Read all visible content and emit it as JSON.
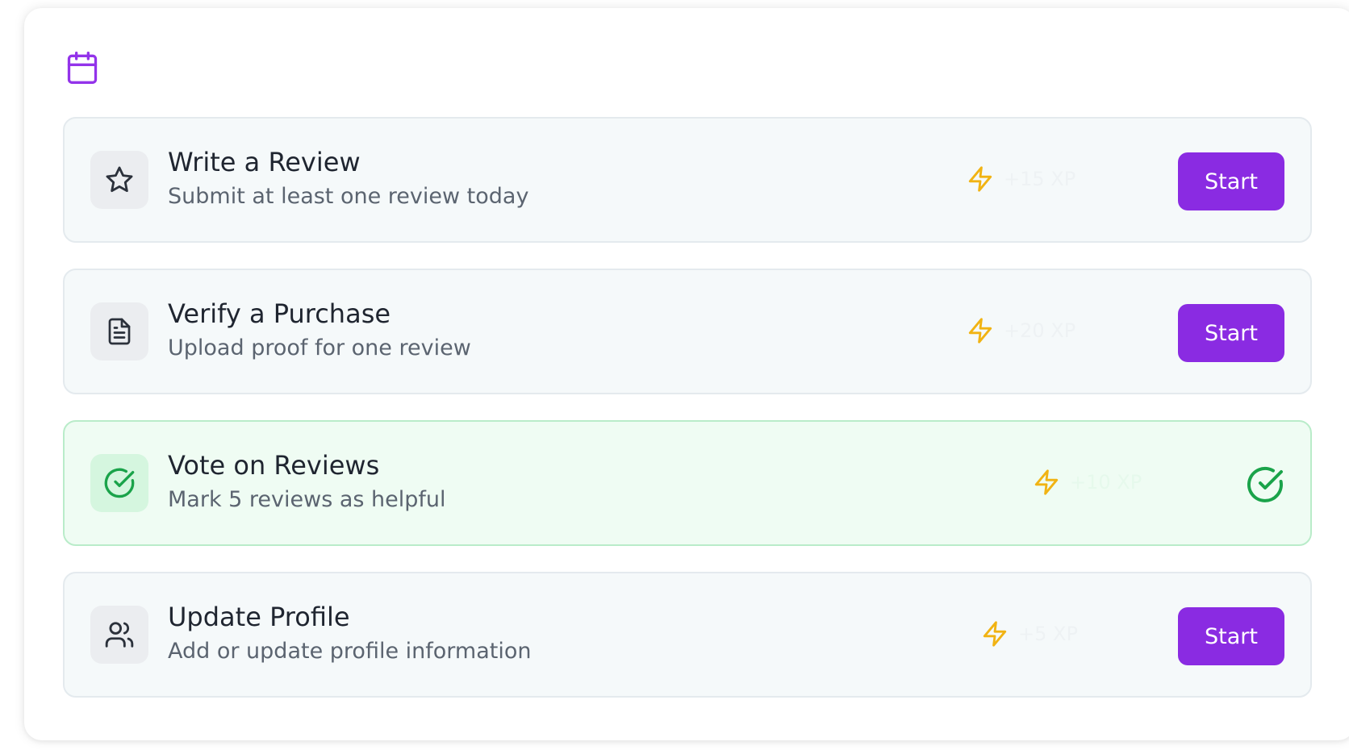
{
  "colors": {
    "accent": "#8a2be2",
    "bolt": "#f1b313",
    "success": "#1aa34a"
  },
  "header": {
    "icon": "calendar-icon"
  },
  "tasks": [
    {
      "icon": "star-icon",
      "title": "Write a Review",
      "description": "Submit at least one review today",
      "reward": "+15 XP",
      "status": "pending",
      "action_label": "Start"
    },
    {
      "icon": "file-text-icon",
      "title": "Verify a Purchase",
      "description": "Upload proof for one review",
      "reward": "+20 XP",
      "status": "pending",
      "action_label": "Start"
    },
    {
      "icon": "check-circle-icon",
      "title": "Vote on Reviews",
      "description": "Mark 5 reviews as helpful",
      "reward": "+10 XP",
      "status": "completed",
      "action_label": ""
    },
    {
      "icon": "users-icon",
      "title": "Update Profile",
      "description": "Add or update profile information",
      "reward": "+5 XP",
      "status": "pending",
      "action_label": "Start"
    }
  ]
}
